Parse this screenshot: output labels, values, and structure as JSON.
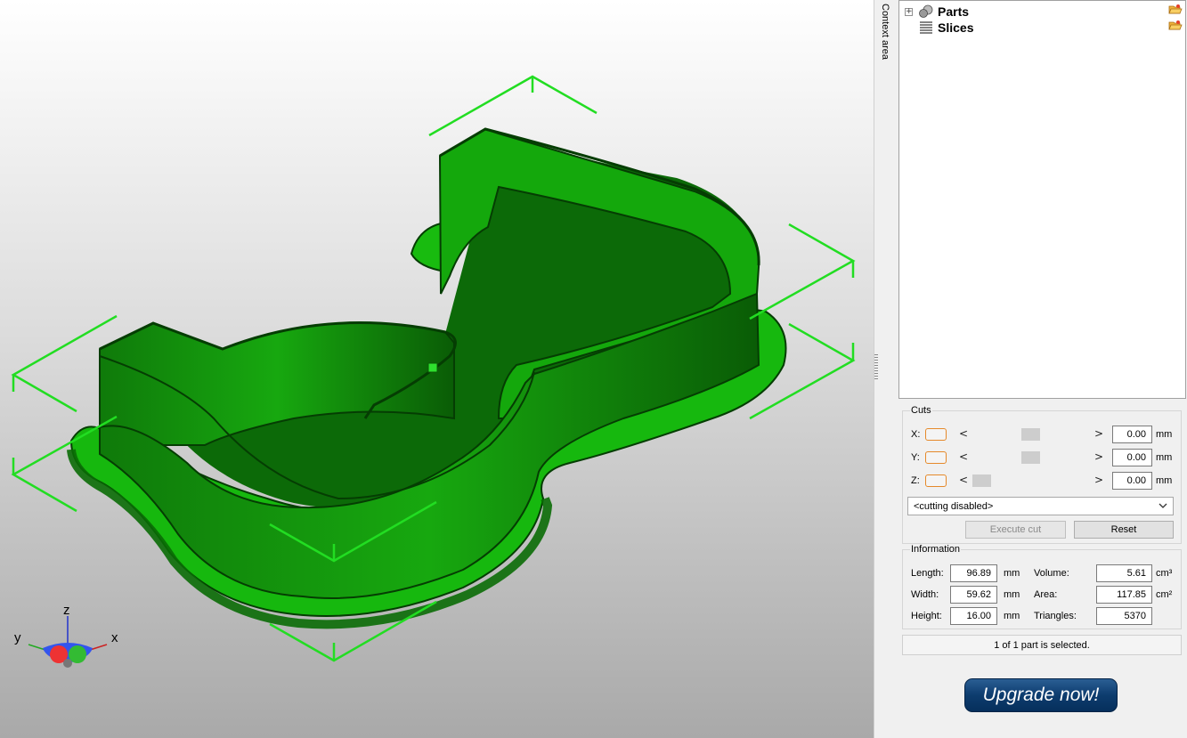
{
  "tree": {
    "items": [
      {
        "label": "Parts",
        "expander": "+",
        "icon": "parts-spheres-icon"
      },
      {
        "label": "Slices",
        "icon": "slices-lines-icon"
      }
    ],
    "context_label": "Context area"
  },
  "viewport": {
    "axes": {
      "x": "x",
      "y": "y",
      "z": "z"
    },
    "model_color": "#19c40e",
    "bbox_color": "#22dd22"
  },
  "cuts": {
    "title": "Cuts",
    "rows": [
      {
        "axis": "X:",
        "value": "0.00",
        "unit": "mm",
        "slider_fraction": 0.5
      },
      {
        "axis": "Y:",
        "value": "0.00",
        "unit": "mm",
        "slider_fraction": 0.5
      },
      {
        "axis": "Z:",
        "value": "0.00",
        "unit": "mm",
        "slider_fraction": 0.0
      }
    ],
    "arrow_left": "<",
    "arrow_right": ">",
    "mode_select": "<cutting disabled>",
    "execute_label": "Execute cut",
    "reset_label": "Reset"
  },
  "information": {
    "title": "Information",
    "length_label": "Length:",
    "length_value": "96.89",
    "length_unit": "mm",
    "width_label": "Width:",
    "width_value": "59.62",
    "width_unit": "mm",
    "height_label": "Height:",
    "height_value": "16.00",
    "height_unit": "mm",
    "volume_label": "Volume:",
    "volume_value": "5.61",
    "volume_unit": "cm³",
    "area_label": "Area:",
    "area_value": "117.85",
    "area_unit": "cm²",
    "triangles_label": "Triangles:",
    "triangles_value": "5370"
  },
  "status": "1 of 1 part is selected.",
  "upgrade_label": "Upgrade now!"
}
